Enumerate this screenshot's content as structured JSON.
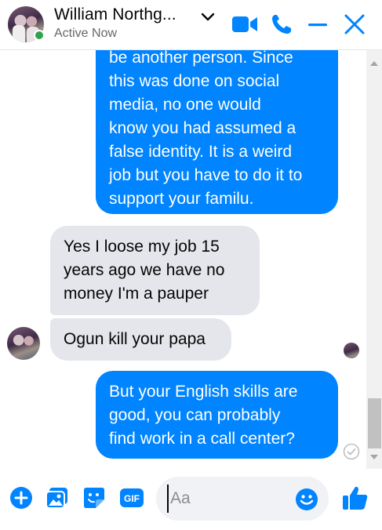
{
  "header": {
    "contact_name": "William Northg...",
    "status": "Active Now",
    "icons": [
      "chevron-down-icon",
      "video-call-icon",
      "phone-icon",
      "minimize-icon",
      "close-icon"
    ]
  },
  "messages": [
    {
      "direction": "sent",
      "lines": [
        "be another person. Since",
        "this was done on social",
        "media,  no one would",
        "know you had assumed a",
        "false identity. It is a weird",
        "job but you have to do it to",
        "support your familu."
      ]
    },
    {
      "direction": "received",
      "lines": [
        "Yes I loose my job 15",
        "years ago we have no",
        "money I'm a pauper"
      ]
    },
    {
      "direction": "received",
      "lines": [
        "Ogun kill your papa"
      ]
    },
    {
      "direction": "sent",
      "lines": [
        "But your English skills are",
        "good, you can probably",
        "find work in a call center?"
      ]
    }
  ],
  "composer": {
    "placeholder": "Aa",
    "icons": [
      "plus-icon",
      "photo-icon",
      "sticker-icon",
      "gif-icon",
      "emoji-icon",
      "like-icon"
    ],
    "gif_label": "GIF"
  },
  "colors": {
    "accent": "#0084ff",
    "received_bubble": "#e4e6eb",
    "online": "#31a24c"
  }
}
